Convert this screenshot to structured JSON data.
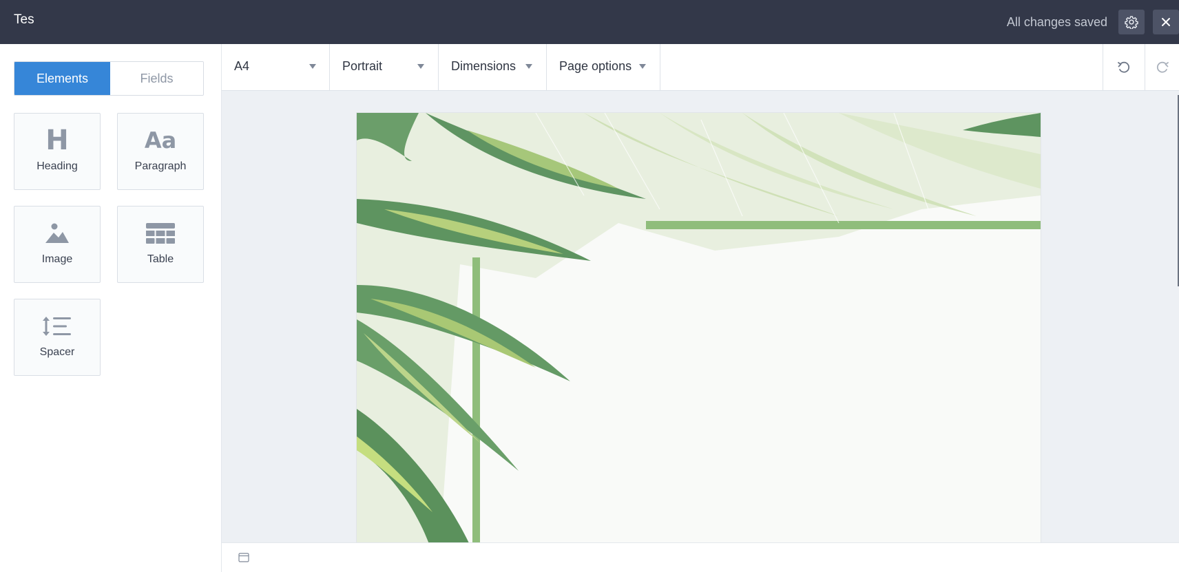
{
  "header": {
    "title": "Tes",
    "save_status": "All changes saved",
    "settings_icon": "gear-icon",
    "close_icon": "close-icon"
  },
  "sidebar": {
    "tabs": [
      {
        "label": "Elements",
        "active": true
      },
      {
        "label": "Fields",
        "active": false
      }
    ],
    "elements": [
      {
        "label": "Heading",
        "glyph": "H",
        "icon": "heading-icon"
      },
      {
        "label": "Paragraph",
        "glyph": "Aa",
        "icon": "paragraph-icon"
      },
      {
        "label": "Image",
        "icon": "image-icon"
      },
      {
        "label": "Table",
        "icon": "table-icon"
      },
      {
        "label": "Spacer",
        "icon": "spacer-icon"
      }
    ]
  },
  "toolbar": {
    "page_size": "A4",
    "orientation": "Portrait",
    "dimensions": "Dimensions",
    "page_options": "Page options",
    "undo_icon": "undo-icon",
    "redo_icon": "redo-icon"
  },
  "canvas": {
    "background_image": "tropical-leaves-frame"
  },
  "colors": {
    "header_bg": "#333849",
    "accent": "#3686d8",
    "canvas_bg": "#edf0f4",
    "leaf_dark": "#5e9460",
    "leaf_light": "#d5e3c0"
  }
}
